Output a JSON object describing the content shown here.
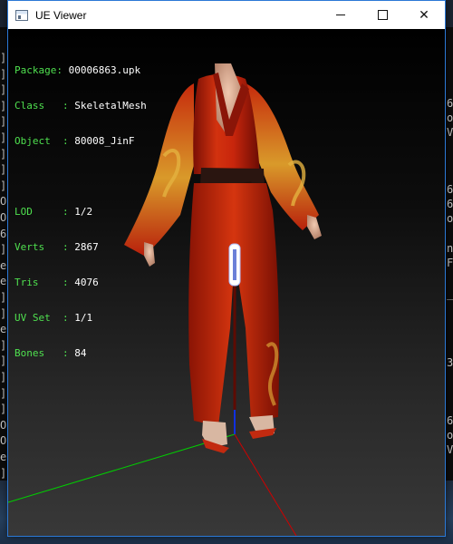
{
  "window": {
    "title": "UE Viewer",
    "minimize_symbol": "—",
    "close_symbol": "✕"
  },
  "mesh_info": {
    "package_label": "Package: ",
    "package_value": "00006863.upk",
    "class_label": "Class   : ",
    "class_value": "SkeletalMesh",
    "object_label": "Object  : ",
    "object_value": "80008_JinF",
    "lod_label": "LOD     : ",
    "lod_value": "1/2",
    "verts_label": "Verts   : ",
    "verts_value": "2867",
    "tris_label": "Tris    : ",
    "tris_value": "4076",
    "uvset_label": "UV Set  : ",
    "uvset_value": "1/1",
    "bones_label": "Bones   : ",
    "bones_value": "84"
  },
  "background_console": {
    "left_chars": [
      "]",
      "]",
      "]",
      "]",
      "]",
      "]",
      "]",
      "]",
      "]",
      "O",
      "O",
      "6",
      "]",
      "e",
      "e",
      "]",
      "]",
      "e",
      "]",
      "]",
      "]",
      "]",
      "]",
      "O",
      "O",
      "e",
      "]"
    ],
    "right_chars": [
      "6",
      "o",
      "V",
      "6",
      "6",
      "o",
      "n",
      "F",
      "_",
      "3",
      "6",
      "o",
      "V"
    ]
  },
  "colors": {
    "info_label": "#4fe04f",
    "info_value": "#ffffff",
    "axis_x": "#00d000",
    "axis_y": "#d00000",
    "axis_z": "#1030e0",
    "robe": "#b8200c"
  }
}
